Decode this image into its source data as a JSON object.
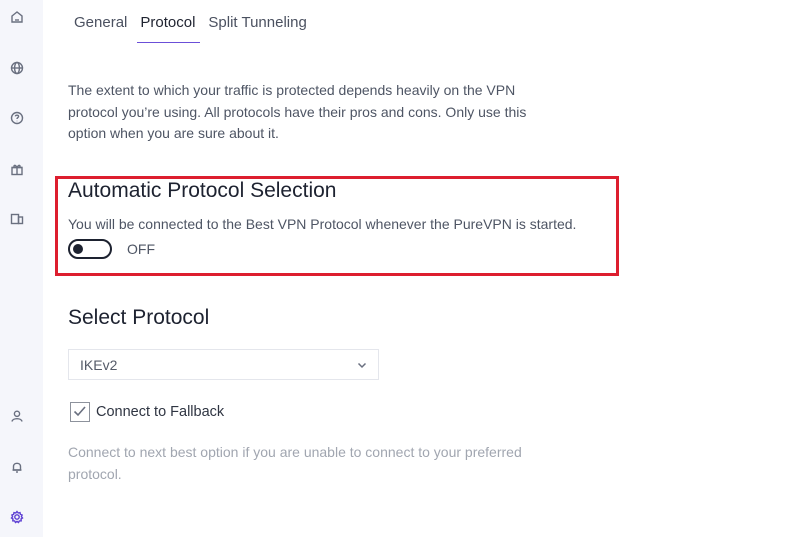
{
  "sidebar": {
    "icons": [
      {
        "name": "home-icon"
      },
      {
        "name": "globe-icon"
      },
      {
        "name": "help-icon"
      },
      {
        "name": "gift-icon"
      },
      {
        "name": "devices-icon"
      },
      {
        "name": "user-icon"
      },
      {
        "name": "bell-icon"
      },
      {
        "name": "settings-icon"
      }
    ]
  },
  "tabs": [
    {
      "label": "General"
    },
    {
      "label": "Protocol"
    },
    {
      "label": "Split Tunneling"
    }
  ],
  "active_tab": "Protocol",
  "description": "The extent to which your traffic is protected depends heavily on the VPN protocol you’re using. All protocols have their pros and cons. Only use this option when you are sure about it.",
  "auto_protocol": {
    "title": "Automatic Protocol Selection",
    "description": "You will be connected to the Best VPN Protocol whenever the PureVPN is started.",
    "toggle_state": "OFF"
  },
  "select_protocol": {
    "title": "Select Protocol",
    "selected": "IKEv2"
  },
  "fallback": {
    "label": "Connect to Fallback",
    "checked": true,
    "description": "Connect to next best option if you are unable to connect to your preferred protocol."
  },
  "colors": {
    "accent": "#6b4fd8",
    "highlight_border": "#dd1e2f",
    "sidebar_bg": "#f5f6fb"
  }
}
